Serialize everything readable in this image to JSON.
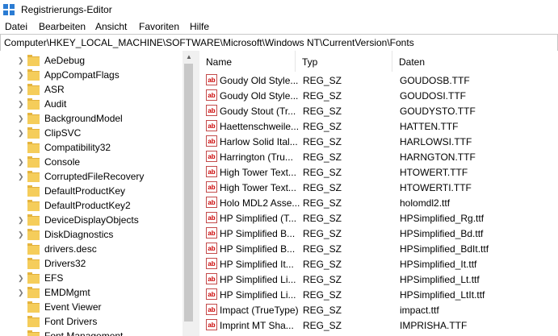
{
  "window": {
    "title": "Registrierungs-Editor"
  },
  "menu": [
    "Datei",
    "Bearbeiten",
    "Ansicht",
    "Favoriten",
    "Hilfe"
  ],
  "address": "Computer\\HKEY_LOCAL_MACHINE\\SOFTWARE\\Microsoft\\Windows NT\\CurrentVersion\\Fonts",
  "tree": [
    {
      "label": "AeDebug",
      "expandable": true
    },
    {
      "label": "AppCompatFlags",
      "expandable": true
    },
    {
      "label": "ASR",
      "expandable": true
    },
    {
      "label": "Audit",
      "expandable": true
    },
    {
      "label": "BackgroundModel",
      "expandable": true
    },
    {
      "label": "ClipSVC",
      "expandable": true
    },
    {
      "label": "Compatibility32",
      "expandable": false
    },
    {
      "label": "Console",
      "expandable": true
    },
    {
      "label": "CorruptedFileRecovery",
      "expandable": true
    },
    {
      "label": "DefaultProductKey",
      "expandable": false
    },
    {
      "label": "DefaultProductKey2",
      "expandable": false
    },
    {
      "label": "DeviceDisplayObjects",
      "expandable": true
    },
    {
      "label": "DiskDiagnostics",
      "expandable": true
    },
    {
      "label": "drivers.desc",
      "expandable": false
    },
    {
      "label": "Drivers32",
      "expandable": false
    },
    {
      "label": "EFS",
      "expandable": true
    },
    {
      "label": "EMDMgmt",
      "expandable": true
    },
    {
      "label": "Event Viewer",
      "expandable": false
    },
    {
      "label": "Font Drivers",
      "expandable": false
    },
    {
      "label": "Font Management",
      "expandable": false
    }
  ],
  "columns": {
    "name": "Name",
    "type": "Typ",
    "data": "Daten"
  },
  "rows": [
    {
      "name": "Goudy Old Style...",
      "type": "REG_SZ",
      "data": "GOUDOSB.TTF"
    },
    {
      "name": "Goudy Old Style...",
      "type": "REG_SZ",
      "data": "GOUDOSI.TTF"
    },
    {
      "name": "Goudy Stout (Tr...",
      "type": "REG_SZ",
      "data": "GOUDYSTO.TTF"
    },
    {
      "name": "Haettenschweile...",
      "type": "REG_SZ",
      "data": "HATTEN.TTF"
    },
    {
      "name": "Harlow Solid Ital...",
      "type": "REG_SZ",
      "data": "HARLOWSI.TTF"
    },
    {
      "name": "Harrington (Tru...",
      "type": "REG_SZ",
      "data": "HARNGTON.TTF"
    },
    {
      "name": "High Tower Text...",
      "type": "REG_SZ",
      "data": "HTOWERT.TTF"
    },
    {
      "name": "High Tower Text...",
      "type": "REG_SZ",
      "data": "HTOWERTI.TTF"
    },
    {
      "name": "Holo MDL2 Asse...",
      "type": "REG_SZ",
      "data": "holomdl2.ttf"
    },
    {
      "name": "HP Simplified (T...",
      "type": "REG_SZ",
      "data": "HPSimplified_Rg.ttf"
    },
    {
      "name": "HP Simplified B...",
      "type": "REG_SZ",
      "data": "HPSimplified_Bd.ttf"
    },
    {
      "name": "HP Simplified B...",
      "type": "REG_SZ",
      "data": "HPSimplified_BdIt.ttf"
    },
    {
      "name": "HP Simplified It...",
      "type": "REG_SZ",
      "data": "HPSimplified_It.ttf"
    },
    {
      "name": "HP Simplified Li...",
      "type": "REG_SZ",
      "data": "HPSimplified_Lt.ttf"
    },
    {
      "name": "HP Simplified Li...",
      "type": "REG_SZ",
      "data": "HPSimplified_LtIt.ttf"
    },
    {
      "name": "Impact (TrueType)",
      "type": "REG_SZ",
      "data": "impact.ttf"
    },
    {
      "name": "Imprint MT Sha...",
      "type": "REG_SZ",
      "data": "IMPRISHA.TTF"
    }
  ],
  "icons": {
    "app": "regedit-icon",
    "folder": "folder-icon",
    "value": "string-value-icon"
  },
  "colors": {
    "folder": "#f5cd5b",
    "value_icon_border": "#c34a4a"
  }
}
